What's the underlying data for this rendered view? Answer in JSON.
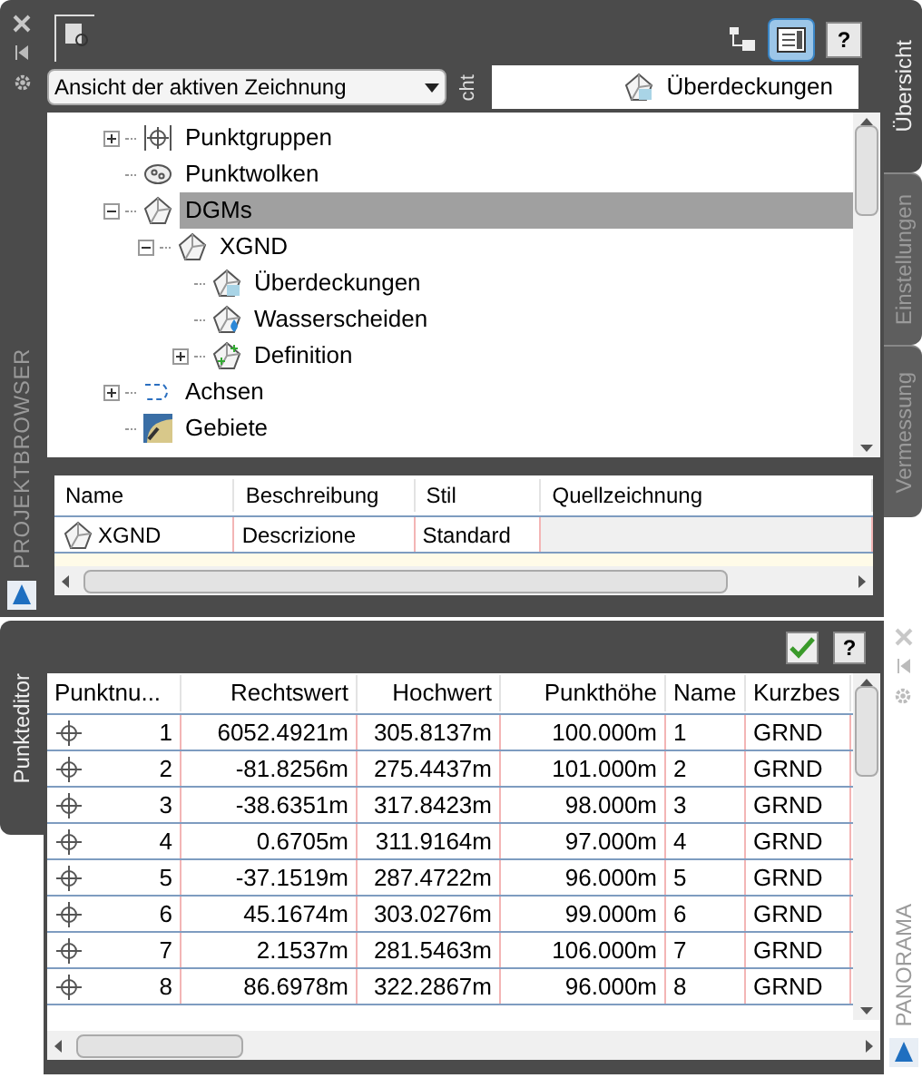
{
  "project_browser": {
    "title": "PROJEKTBROWSER",
    "help_button": "?",
    "view_dropdown": {
      "value": "Ansicht der aktiven Zeichnung"
    },
    "clipped_tab": "cht",
    "preview_item": "Überdeckungen",
    "side_tabs": [
      {
        "label": "Übersicht",
        "selected": true
      },
      {
        "label": "Einstellungen",
        "selected": false
      },
      {
        "label": "Vermessung",
        "selected": false
      }
    ],
    "tree": [
      {
        "label": "Punktgruppen",
        "kind": "point-group",
        "expanded": false,
        "selected": false
      },
      {
        "label": "Punktwolken",
        "kind": "point-cloud",
        "selected": false
      },
      {
        "label": "DGMs",
        "kind": "surface",
        "expanded": true,
        "selected": true,
        "children": [
          {
            "label": "XGND",
            "kind": "surface",
            "expanded": true,
            "selected": false,
            "children": [
              {
                "label": "Überdeckungen",
                "kind": "overlay",
                "selected": false
              },
              {
                "label": "Wasserscheiden",
                "kind": "watershed",
                "selected": false
              },
              {
                "label": "Definition",
                "kind": "definition",
                "expanded": false,
                "selected": false
              }
            ]
          }
        ]
      },
      {
        "label": "Achsen",
        "kind": "alignment",
        "expanded": false,
        "selected": false
      },
      {
        "label": "Gebiete",
        "kind": "site",
        "selected": false
      }
    ],
    "detail": {
      "columns": [
        "Name",
        "Beschreibung",
        "Stil",
        "Quellzeichnung"
      ],
      "rows": [
        [
          "XGND",
          "Descrizione",
          "Standard",
          ""
        ]
      ]
    }
  },
  "point_editor": {
    "tab": "Punkteditor",
    "help_button": "?",
    "side_title": "PANORAMA",
    "columns": [
      "Punktnu...",
      "Rechtswert",
      "Hochwert",
      "Punkthöhe",
      "Name",
      "Kurzbes"
    ],
    "rows": [
      [
        "1",
        "6052.4921m",
        "305.8137m",
        "100.000m",
        "1",
        "GRND"
      ],
      [
        "2",
        "-81.8256m",
        "275.4437m",
        "101.000m",
        "2",
        "GRND"
      ],
      [
        "3",
        "-38.6351m",
        "317.8423m",
        "98.000m",
        "3",
        "GRND"
      ],
      [
        "4",
        "0.6705m",
        "311.9164m",
        "97.000m",
        "4",
        "GRND"
      ],
      [
        "5",
        "-37.1519m",
        "287.4722m",
        "96.000m",
        "5",
        "GRND"
      ],
      [
        "6",
        "45.1674m",
        "303.0276m",
        "99.000m",
        "6",
        "GRND"
      ],
      [
        "7",
        "2.1537m",
        "281.5463m",
        "106.000m",
        "7",
        "GRND"
      ],
      [
        "8",
        "86.6978m",
        "322.2867m",
        "96.000m",
        "8",
        "GRND"
      ]
    ]
  }
}
